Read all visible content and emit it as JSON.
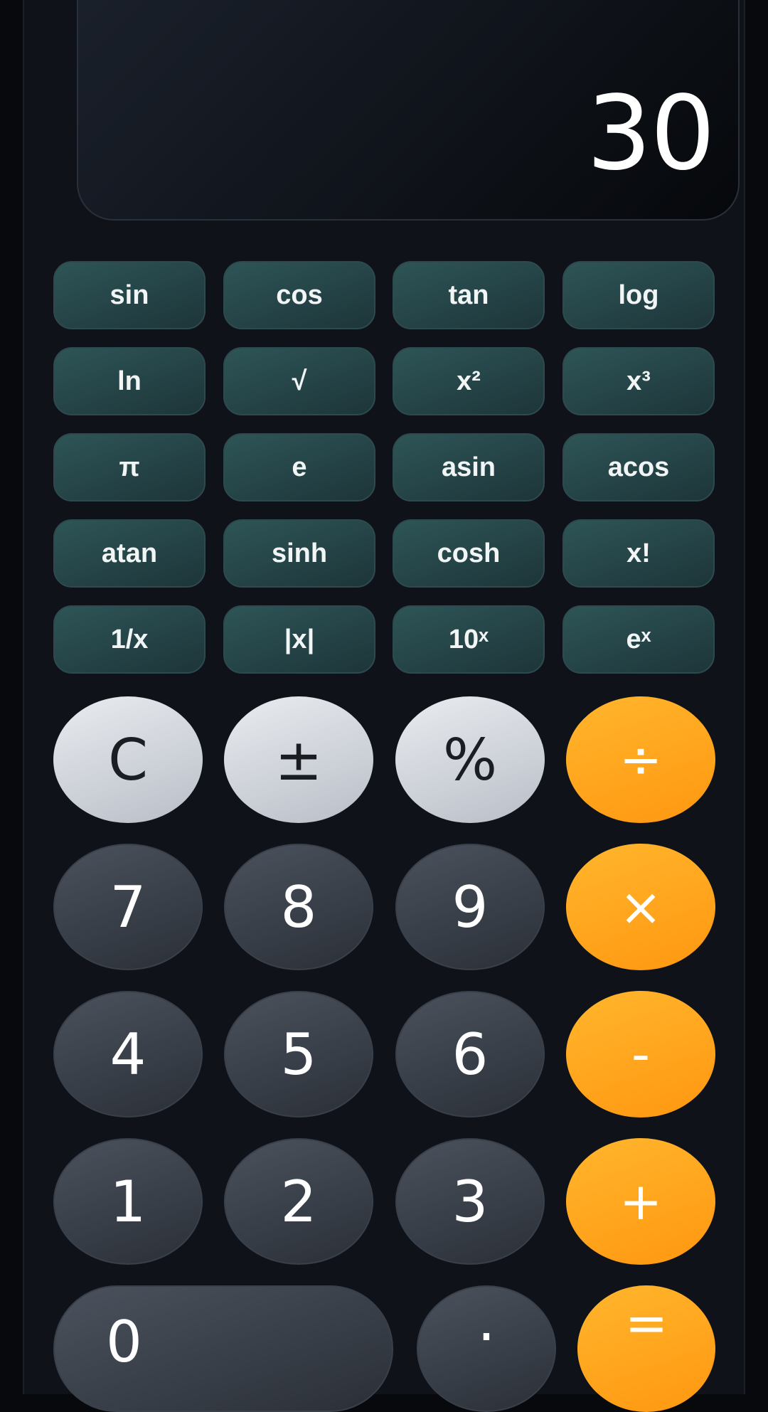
{
  "display": {
    "value": "30"
  },
  "scientific_rows": [
    [
      "sin",
      "cos",
      "tan",
      "log"
    ],
    [
      "ln",
      "√",
      "x²",
      "x³"
    ],
    [
      "π",
      "e",
      "asin",
      "acos"
    ],
    [
      "atan",
      "sinh",
      "cosh",
      "x!"
    ],
    [
      "1/x",
      "|x|",
      "10ˣ",
      "eˣ"
    ]
  ],
  "keypad": {
    "clear": "C",
    "plus_minus": "±",
    "percent": "%",
    "divide": "÷",
    "seven": "7",
    "eight": "8",
    "nine": "9",
    "multiply": "×",
    "four": "4",
    "five": "5",
    "six": "6",
    "subtract": "-",
    "one": "1",
    "two": "2",
    "three": "3",
    "add": "+",
    "zero": "0",
    "decimal": ".",
    "equals": "="
  },
  "colors": {
    "scientific_button": "#2e5557",
    "number_button": "#3d434d",
    "function_button": "#d8dce2",
    "operator_button": "#ffa51f",
    "background": "#0f1319"
  }
}
